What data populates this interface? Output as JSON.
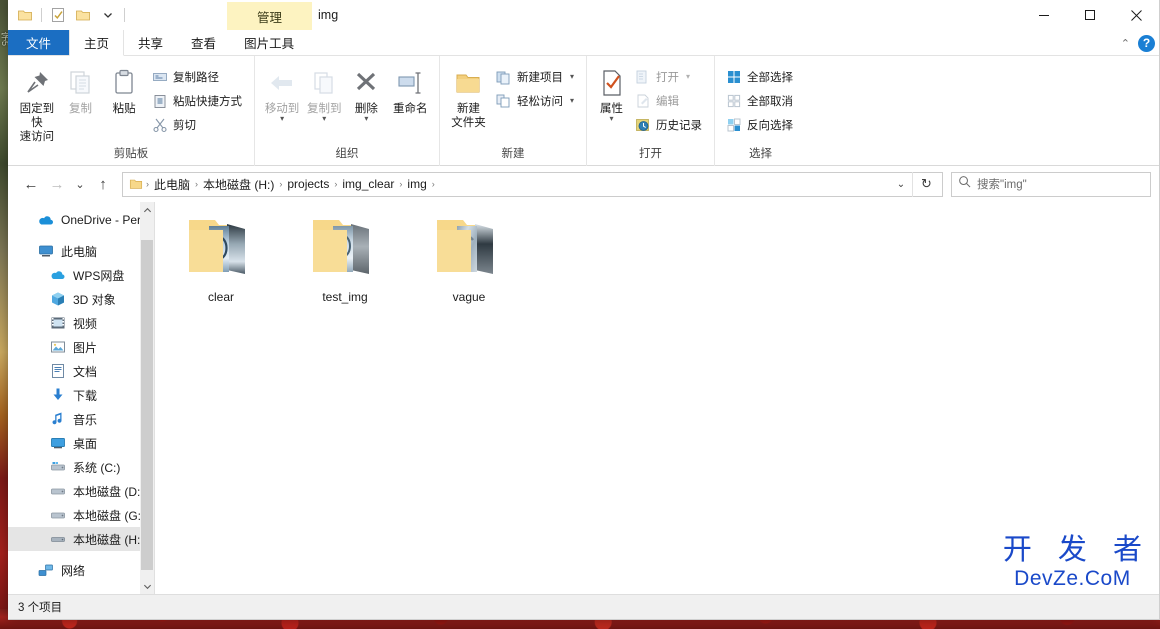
{
  "window": {
    "title": "img",
    "contextual_tab": "管理",
    "minimize": "—",
    "maximize": "□",
    "close": "✕",
    "collapse_ribbon": "⌃",
    "help": "?"
  },
  "quick_access": [
    {
      "name": "properties-quick-icon",
      "label": ""
    },
    {
      "name": "new-folder-quick-icon",
      "label": ""
    },
    {
      "name": "undo-quick-icon",
      "label": ""
    },
    {
      "name": "customize-quick-caret",
      "label": "▾"
    }
  ],
  "tabs": [
    {
      "label": "文件",
      "kind": "file"
    },
    {
      "label": "主页",
      "kind": "active"
    },
    {
      "label": "共享",
      "kind": "normal"
    },
    {
      "label": "查看",
      "kind": "normal"
    },
    {
      "label": "图片工具",
      "kind": "contextual"
    }
  ],
  "ribbon": {
    "groups": [
      {
        "label": "剪贴板",
        "big": [
          {
            "label": "固定到快\n速访问",
            "icon": "pin-icon",
            "dim": false
          },
          {
            "label": "复制",
            "icon": "copy-icon",
            "dim": true
          },
          {
            "label": "粘贴",
            "icon": "paste-icon",
            "dim": false
          }
        ],
        "small": [
          {
            "label": "复制路径",
            "icon": "copy-path-icon",
            "dim": false
          },
          {
            "label": "粘贴快捷方式",
            "icon": "paste-shortcut-icon",
            "dim": false
          },
          {
            "label": "剪切",
            "icon": "cut-icon",
            "dim": false
          }
        ]
      },
      {
        "label": "组织",
        "big": [
          {
            "label": "移动到",
            "icon": "move-to-icon",
            "dim": true
          },
          {
            "label": "复制到",
            "icon": "copy-to-icon",
            "dim": true
          },
          {
            "label": "删除",
            "icon": "delete-icon",
            "dim": false
          },
          {
            "label": "重命名",
            "icon": "rename-icon",
            "dim": false
          }
        ],
        "small": []
      },
      {
        "label": "新建",
        "big": [
          {
            "label": "新建\n文件夹",
            "icon": "new-folder-icon",
            "dim": false
          }
        ],
        "small": [
          {
            "label": "新建项目",
            "icon": "new-item-icon",
            "dim": false,
            "caret": true
          },
          {
            "label": "轻松访问",
            "icon": "easy-access-icon",
            "dim": false,
            "caret": true
          }
        ]
      },
      {
        "label": "打开",
        "big": [
          {
            "label": "属性",
            "icon": "properties-icon",
            "dim": false
          }
        ],
        "small": [
          {
            "label": "打开",
            "icon": "open-icon",
            "dim": true,
            "caret": true
          },
          {
            "label": "编辑",
            "icon": "edit-icon",
            "dim": true
          },
          {
            "label": "历史记录",
            "icon": "history-icon",
            "dim": false
          }
        ]
      },
      {
        "label": "选择",
        "big": [],
        "small": [
          {
            "label": "全部选择",
            "icon": "select-all-icon",
            "dim": false
          },
          {
            "label": "全部取消",
            "icon": "select-none-icon",
            "dim": false
          },
          {
            "label": "反向选择",
            "icon": "invert-selection-icon",
            "dim": false
          }
        ]
      }
    ]
  },
  "address": {
    "back": "←",
    "forward": "→",
    "recent": "⌄",
    "up": "↑",
    "breadcrumbs": [
      "此电脑",
      "本地磁盘 (H:)",
      "projects",
      "img_clear",
      "img"
    ],
    "separator": "›",
    "dropdown": "⌄",
    "refresh": "↻"
  },
  "search": {
    "placeholder": "搜索\"img\"",
    "value": "",
    "icon": "search-icon"
  },
  "sidebar": {
    "scroll_up": "⌃",
    "scroll_down": "⌄",
    "items": [
      {
        "label": "OneDrive - Pers",
        "icon": "onedrive-icon",
        "indent": 0,
        "selected": false
      },
      {
        "label": "此电脑",
        "icon": "this-pc-icon",
        "indent": 0,
        "selected": false
      },
      {
        "label": "WPS网盘",
        "icon": "wps-cloud-icon",
        "indent": 1,
        "selected": false
      },
      {
        "label": "3D 对象",
        "icon": "3d-objects-icon",
        "indent": 1,
        "selected": false
      },
      {
        "label": "视频",
        "icon": "videos-icon",
        "indent": 1,
        "selected": false
      },
      {
        "label": "图片",
        "icon": "pictures-icon",
        "indent": 1,
        "selected": false
      },
      {
        "label": "文档",
        "icon": "documents-icon",
        "indent": 1,
        "selected": false
      },
      {
        "label": "下载",
        "icon": "downloads-icon",
        "indent": 1,
        "selected": false
      },
      {
        "label": "音乐",
        "icon": "music-icon",
        "indent": 1,
        "selected": false
      },
      {
        "label": "桌面",
        "icon": "desktop-icon",
        "indent": 1,
        "selected": false
      },
      {
        "label": "系统 (C:)",
        "icon": "system-drive-icon",
        "indent": 1,
        "selected": false
      },
      {
        "label": "本地磁盘 (D:)",
        "icon": "local-drive-icon",
        "indent": 1,
        "selected": false
      },
      {
        "label": "本地磁盘 (G:)",
        "icon": "local-drive-icon",
        "indent": 1,
        "selected": false
      },
      {
        "label": "本地磁盘 (H:)",
        "icon": "local-drive-icon",
        "indent": 1,
        "selected": true
      },
      {
        "label": "网络",
        "icon": "network-icon",
        "indent": 0,
        "selected": false
      }
    ]
  },
  "content": {
    "folders": [
      {
        "name": "clear",
        "type": "image-folder"
      },
      {
        "name": "test_img",
        "type": "image-folder"
      },
      {
        "name": "vague",
        "type": "image-folder"
      }
    ]
  },
  "watermark": {
    "cn": "开 发 者",
    "en": "DevZe.CoM",
    "color": "#1a49c9"
  },
  "status": {
    "item_count": "3 个项目"
  },
  "colors": {
    "file_tab": "#1b6ec2",
    "contextual": "#fdf3c1",
    "selection": "#e5e5e5",
    "folder": "#f7d88a"
  }
}
